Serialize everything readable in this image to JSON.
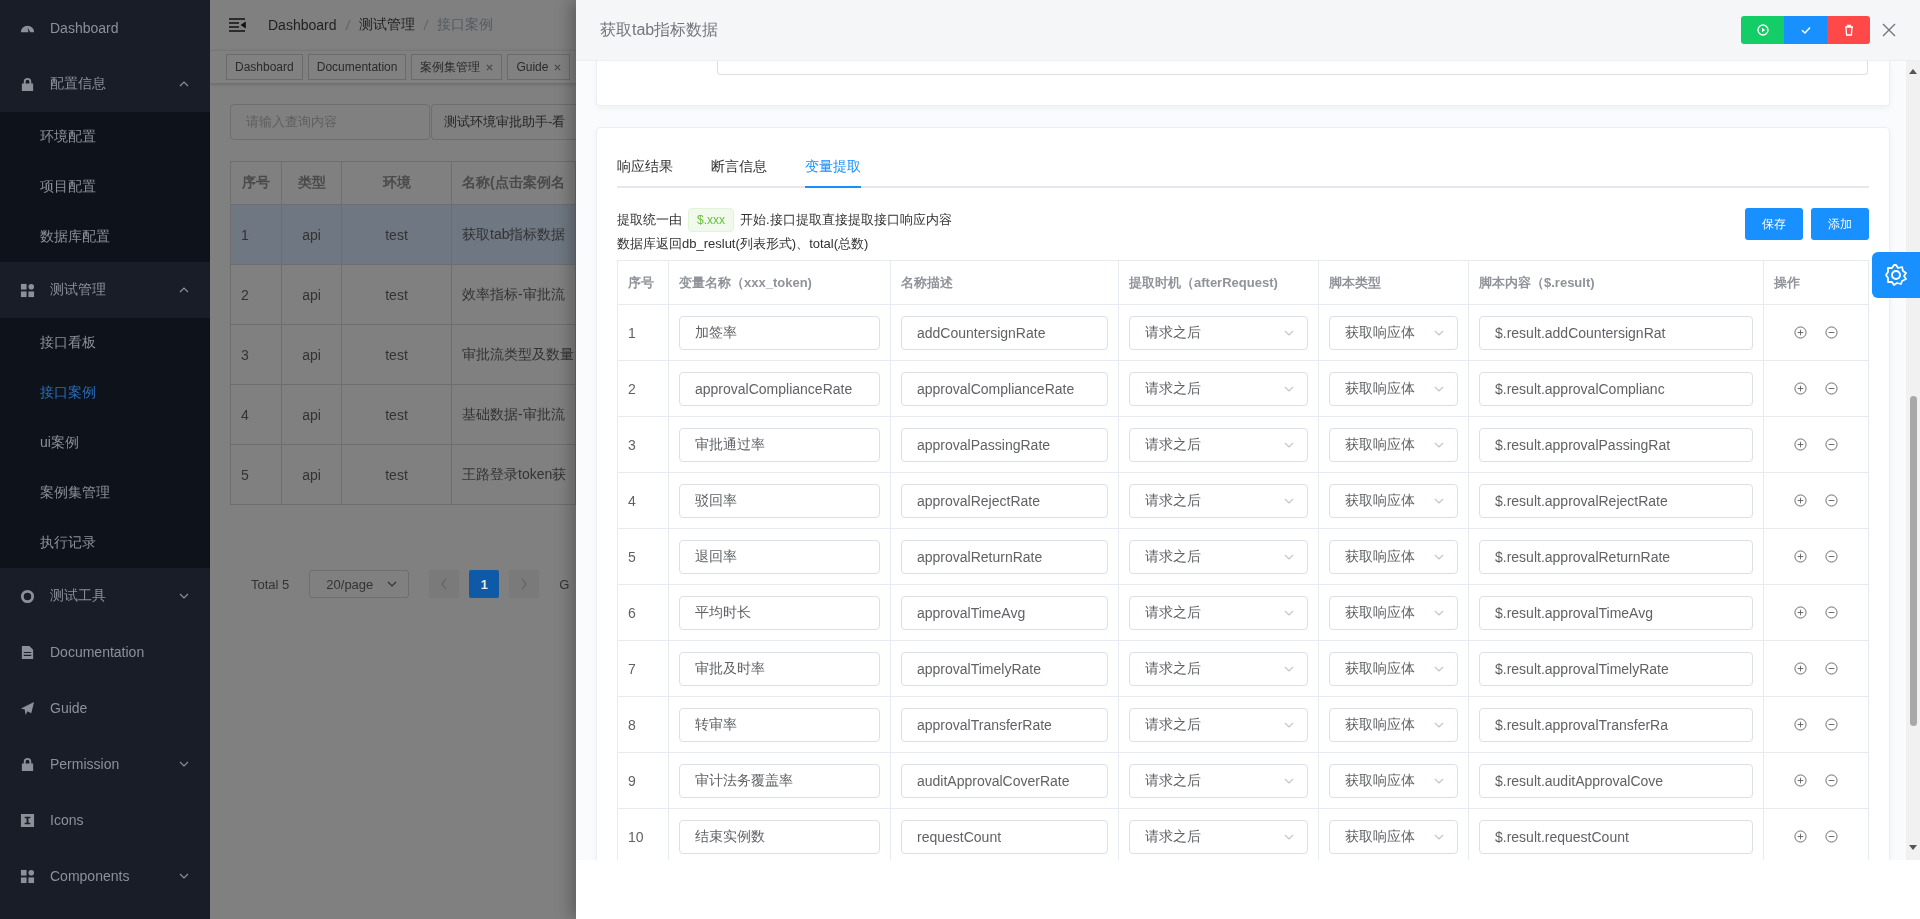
{
  "sidebar": {
    "items": [
      {
        "label": "Dashboard",
        "selected": false
      },
      {
        "label": "配置信息",
        "selected": false,
        "expanded": true,
        "children": [
          {
            "label": "环境配置",
            "selected": false
          },
          {
            "label": "项目配置",
            "selected": false
          },
          {
            "label": "数据库配置",
            "selected": false
          }
        ]
      },
      {
        "label": "测试管理",
        "selected": false,
        "expanded": true,
        "children": [
          {
            "label": "接口看板",
            "selected": false
          },
          {
            "label": "接口案例",
            "selected": true
          },
          {
            "label": "ui案例",
            "selected": false
          },
          {
            "label": "案例集管理",
            "selected": false
          },
          {
            "label": "执行记录",
            "selected": false
          }
        ]
      },
      {
        "label": "测试工具",
        "selected": false,
        "expanded": false
      },
      {
        "label": "Documentation",
        "selected": false
      },
      {
        "label": "Guide",
        "selected": false
      },
      {
        "label": "Permission",
        "selected": false,
        "expanded": false
      },
      {
        "label": "Icons",
        "selected": false
      },
      {
        "label": "Components",
        "selected": false,
        "expanded": false
      }
    ]
  },
  "navbar": {
    "breadcrumb": [
      "Dashboard",
      "测试管理",
      "接口案例"
    ]
  },
  "tags_view": {
    "tags": [
      {
        "label": "Dashboard",
        "closable": false
      },
      {
        "label": "Documentation",
        "closable": false
      },
      {
        "label": "案例集管理",
        "closable": true
      },
      {
        "label": "Guide",
        "closable": true
      }
    ]
  },
  "filter": {
    "search": {
      "placeholder": "请输入查询内容"
    },
    "select": {
      "value": "测试环境审批助手-看"
    }
  },
  "case_table": {
    "columns": [
      "序号",
      "类型",
      "环境",
      "名称(点击案例名"
    ],
    "rows": [
      {
        "cells": [
          "1",
          "api",
          "test",
          "获取tab指标数据"
        ],
        "selected": true
      },
      {
        "cells": [
          "2",
          "api",
          "test",
          "效率指标-审批流"
        ],
        "selected": false
      },
      {
        "cells": [
          "3",
          "api",
          "test",
          "审批流类型及数量"
        ],
        "selected": false
      },
      {
        "cells": [
          "4",
          "api",
          "test",
          "基础数据-审批流"
        ],
        "selected": false
      },
      {
        "cells": [
          "5",
          "api",
          "test",
          "王路登录token获"
        ],
        "selected": false
      }
    ]
  },
  "pagination": {
    "total": "Total 5",
    "page_size": "20/page",
    "pages": [
      {
        "label": "1",
        "selected": true
      }
    ],
    "goto": "G"
  },
  "drawer": {
    "title": "获取tab指标数据",
    "actions": [
      {
        "kind": "run"
      },
      {
        "kind": "confirm"
      },
      {
        "kind": "delete"
      }
    ],
    "tabs": [
      {
        "label": "响应结果",
        "selected": false
      },
      {
        "label": "断言信息",
        "selected": false
      },
      {
        "label": "变量提取",
        "selected": true
      }
    ],
    "hint": {
      "before": "提取统一由",
      "tag": "$.xxx",
      "after": "开始.接口提取直接提取接口响应内容",
      "line2": "数据库返回db_reslut(列表形式)、total(总数)"
    },
    "buttons": [
      "保存",
      "添加"
    ],
    "extract_table": {
      "columns": [
        "序号",
        "变量名称（xxx_token)",
        "名称描述",
        "提取时机（afterRequest)",
        "脚本类型",
        "脚本内容（$.result)",
        "操作"
      ],
      "rows": [
        {
          "index": "1",
          "name": "加签率",
          "description": "addCountersignRate",
          "timing": "请求之后",
          "script_type": "获取响应体",
          "script": "$.result.addCountersignRat"
        },
        {
          "index": "2",
          "name": "approvalComplianceRate",
          "description": "approvalComplianceRate",
          "timing": "请求之后",
          "script_type": "获取响应体",
          "script": "$.result.approvalComplianc"
        },
        {
          "index": "3",
          "name": "审批通过率",
          "description": "approvalPassingRate",
          "timing": "请求之后",
          "script_type": "获取响应体",
          "script": "$.result.approvalPassingRat"
        },
        {
          "index": "4",
          "name": "驳回率",
          "description": "approvalRejectRate",
          "timing": "请求之后",
          "script_type": "获取响应体",
          "script": "$.result.approvalRejectRate"
        },
        {
          "index": "5",
          "name": "退回率",
          "description": "approvalReturnRate",
          "timing": "请求之后",
          "script_type": "获取响应体",
          "script": "$.result.approvalReturnRate"
        },
        {
          "index": "6",
          "name": "平均时长",
          "description": "approvalTimeAvg",
          "timing": "请求之后",
          "script_type": "获取响应体",
          "script": "$.result.approvalTimeAvg"
        },
        {
          "index": "7",
          "name": "审批及时率",
          "description": "approvalTimelyRate",
          "timing": "请求之后",
          "script_type": "获取响应体",
          "script": "$.result.approvalTimelyRate"
        },
        {
          "index": "8",
          "name": "转审率",
          "description": "approvalTransferRate",
          "timing": "请求之后",
          "script_type": "获取响应体",
          "script": "$.result.approvalTransferRa"
        },
        {
          "index": "9",
          "name": "审计法务覆盖率",
          "description": "auditApprovalCoverRate",
          "timing": "请求之后",
          "script_type": "获取响应体",
          "script": "$.result.auditApprovalCove"
        },
        {
          "index": "10",
          "name": "结束实例数",
          "description": "requestCount",
          "timing": "请求之后",
          "script_type": "获取响应体",
          "script": "$.result.requestCount"
        }
      ]
    }
  }
}
